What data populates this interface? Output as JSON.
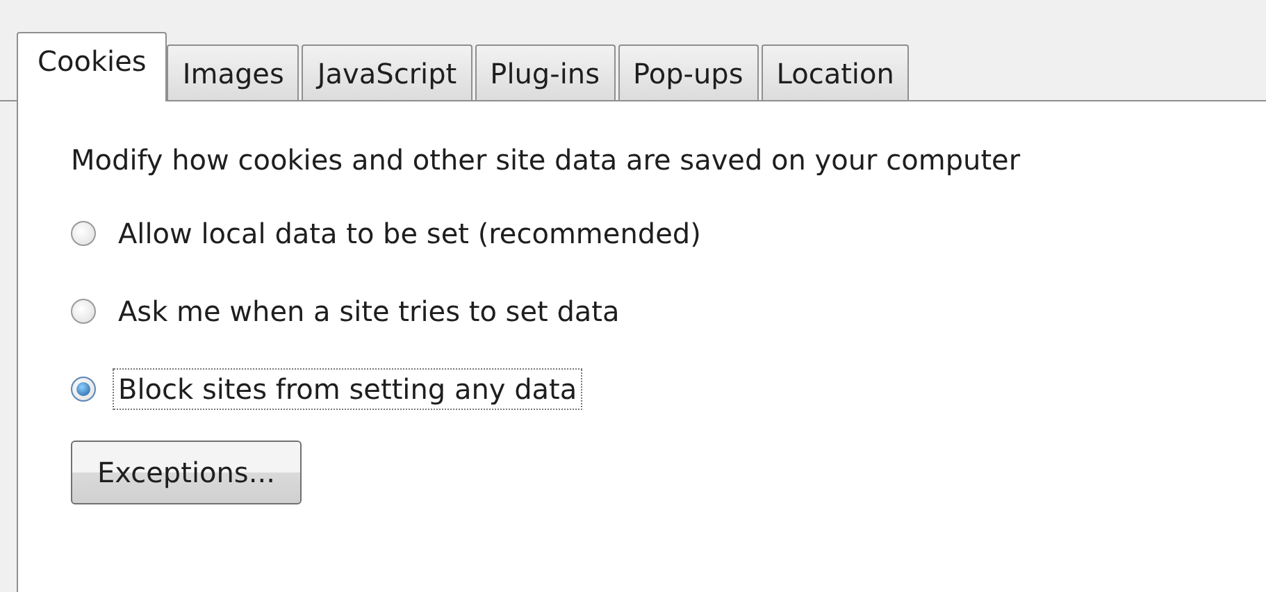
{
  "tabs": [
    {
      "label": "Cookies",
      "selected": true
    },
    {
      "label": "Images",
      "selected": false
    },
    {
      "label": "JavaScript",
      "selected": false
    },
    {
      "label": "Plug-ins",
      "selected": false
    },
    {
      "label": "Pop-ups",
      "selected": false
    },
    {
      "label": "Location",
      "selected": false
    }
  ],
  "description": "Modify how cookies and other site data are saved on your computer",
  "options": [
    {
      "label": "Allow local data to be set (recommended)",
      "selected": false
    },
    {
      "label": "Ask me when a site tries to set data",
      "selected": false
    },
    {
      "label": "Block sites from setting any data",
      "selected": true
    }
  ],
  "buttons": [
    "Exceptions..."
  ]
}
